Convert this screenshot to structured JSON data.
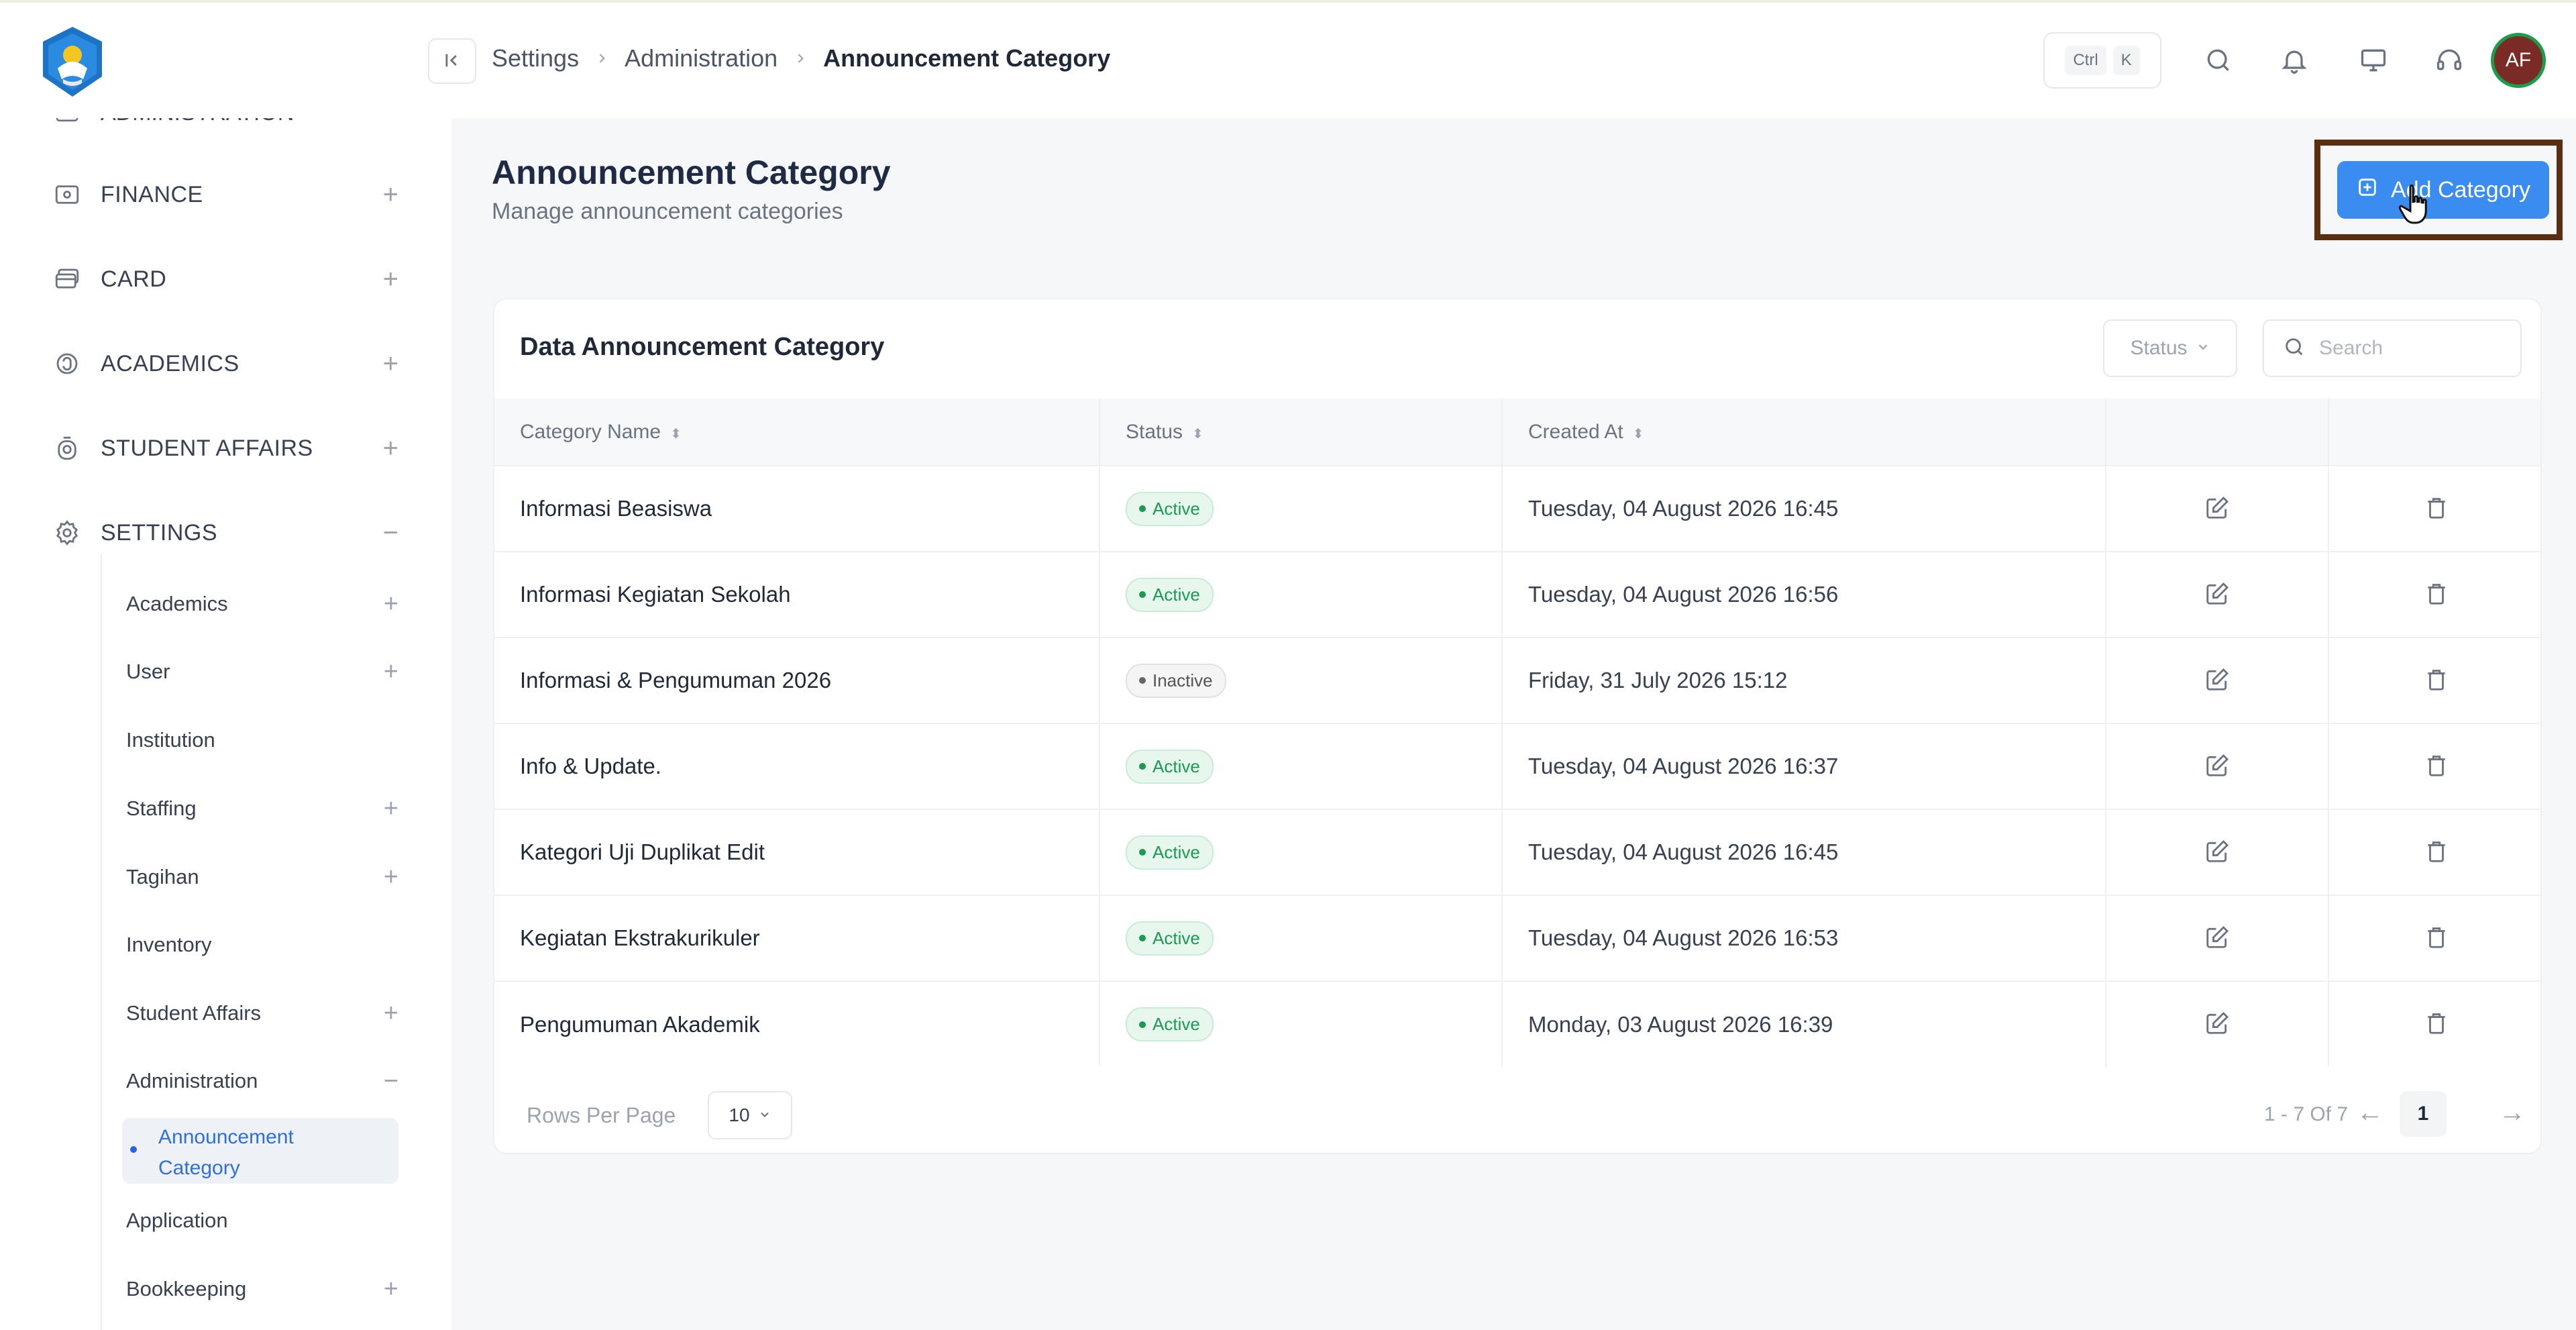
{
  "header": {
    "breadcrumb": [
      "Settings",
      "Administration",
      "Announcement Category"
    ],
    "shortcut_keys": [
      "Ctrl",
      "K"
    ],
    "avatar_initials": "AF",
    "icons": [
      "collapse-sidebar-icon",
      "search-icon",
      "bell-icon",
      "monitor-icon",
      "headset-icon"
    ]
  },
  "sidebar": {
    "clipped_section": "ADMINISTRATION",
    "sections": [
      {
        "label": "FINANCE",
        "icon": "wallet-icon",
        "toggle": "+"
      },
      {
        "label": "CARD",
        "icon": "card-icon",
        "toggle": "+"
      },
      {
        "label": "ACADEMICS",
        "icon": "academics-icon",
        "toggle": "+"
      },
      {
        "label": "STUDENT AFFAIRS",
        "icon": "student-icon",
        "toggle": "+"
      },
      {
        "label": "SETTINGS",
        "icon": "gear-icon",
        "toggle": "−"
      }
    ],
    "settings_items": [
      {
        "label": "Academics",
        "toggle": "+"
      },
      {
        "label": "User",
        "toggle": "+"
      },
      {
        "label": "Institution",
        "toggle": ""
      },
      {
        "label": "Staffing",
        "toggle": "+"
      },
      {
        "label": "Tagihan",
        "toggle": "+"
      },
      {
        "label": "Inventory",
        "toggle": ""
      },
      {
        "label": "Student Affairs",
        "toggle": "+"
      },
      {
        "label": "Administration",
        "toggle": "−"
      }
    ],
    "active_item": "Announcement Category",
    "after_items": [
      {
        "label": "Application",
        "toggle": ""
      },
      {
        "label": "Bookkeeping",
        "toggle": "+"
      }
    ]
  },
  "page": {
    "title": "Announcement Category",
    "subtitle": "Manage announcement categories",
    "add_button": "Add Category"
  },
  "card": {
    "title": "Data Announcement Category",
    "status_filter": "Status",
    "search_placeholder": "Search",
    "columns": [
      "Category Name",
      "Status",
      "Created At",
      "",
      ""
    ],
    "rows": [
      {
        "name": "Informasi Beasiswa",
        "status": "Active",
        "created": "Tuesday, 04 August 2026 16:45"
      },
      {
        "name": "Informasi Kegiatan Sekolah",
        "status": "Active",
        "created": "Tuesday, 04 August 2026 16:56"
      },
      {
        "name": "Informasi & Pengumuman 2026",
        "status": "Inactive",
        "created": "Friday, 31 July 2026 15:12"
      },
      {
        "name": "Info & Update.",
        "status": "Active",
        "created": "Tuesday, 04 August 2026 16:37"
      },
      {
        "name": "Kategori Uji Duplikat Edit",
        "status": "Active",
        "created": "Tuesday, 04 August 2026 16:45"
      },
      {
        "name": "Kegiatan Ekstrakurikuler",
        "status": "Active",
        "created": "Tuesday, 04 August 2026 16:53"
      },
      {
        "name": "Pengumuman Akademik",
        "status": "Active",
        "created": "Monday, 03 August 2026 16:39"
      }
    ],
    "footer": {
      "rows_per_page_label": "Rows Per Page",
      "rows_per_page_value": "10",
      "range_text": "1 - 7 Of 7",
      "current_page": "1",
      "prev_arrow": "←",
      "next_arrow": "→"
    }
  },
  "colors": {
    "accent": "#3b8cf0",
    "active_badge": "#1a9a52",
    "highlight_frame": "#5b2e12",
    "avatar_bg": "#7b2b26"
  }
}
